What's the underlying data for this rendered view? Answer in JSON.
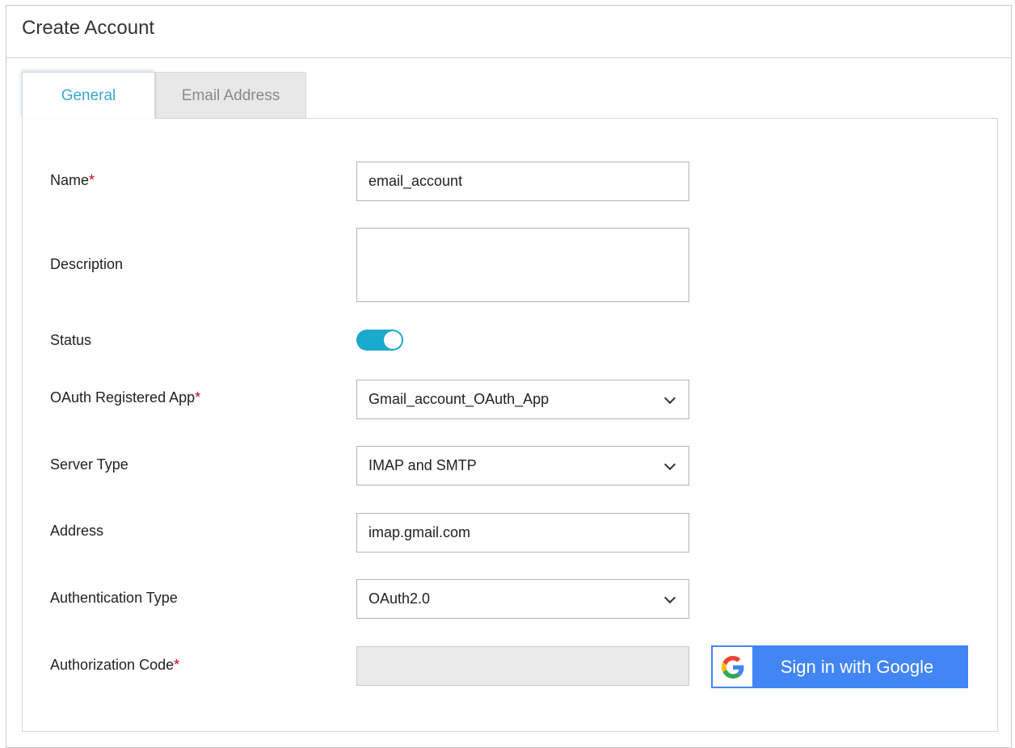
{
  "dialog": {
    "title": "Create Account"
  },
  "tabs": [
    {
      "label": "General",
      "active": true
    },
    {
      "label": "Email Address",
      "active": false
    }
  ],
  "form": {
    "name": {
      "label": "Name",
      "required_mark": "*",
      "value": "email_account"
    },
    "description": {
      "label": "Description",
      "value": ""
    },
    "status": {
      "label": "Status",
      "enabled": true
    },
    "oauth_app": {
      "label": "OAuth Registered App",
      "required_mark": "*",
      "value": "Gmail_account_OAuth_App"
    },
    "server_type": {
      "label": "Server Type",
      "value": "IMAP and SMTP"
    },
    "address": {
      "label": "Address",
      "value": "imap.gmail.com"
    },
    "auth_type": {
      "label": "Authentication Type",
      "value": "OAuth2.0"
    },
    "auth_code": {
      "label": "Authorization Code",
      "required_mark": "*",
      "value": ""
    }
  },
  "google_button": {
    "label": "Sign in with Google",
    "icon": "google-g-icon"
  },
  "colors": {
    "accent": "#1aa9cf",
    "active_tab_text": "#3aa7cf",
    "required": "#d0021b",
    "google_blue": "#4285f4"
  }
}
